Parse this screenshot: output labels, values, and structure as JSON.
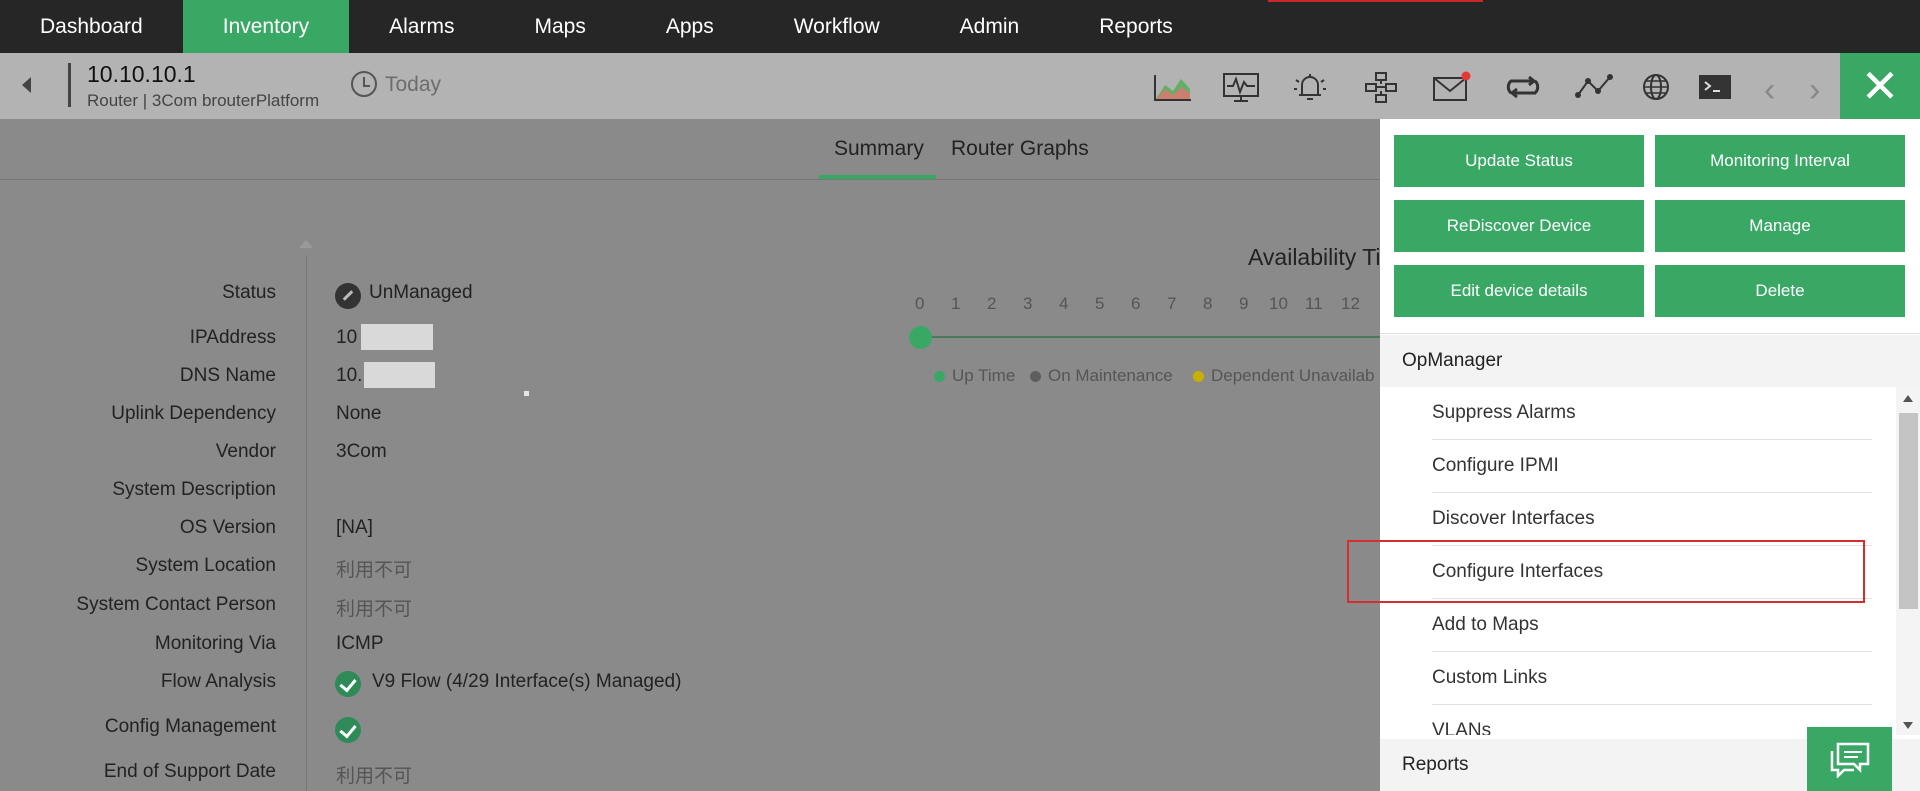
{
  "topnav": {
    "items": [
      {
        "label": "Dashboard",
        "active": false
      },
      {
        "label": "Inventory",
        "active": true
      },
      {
        "label": "Alarms",
        "active": false
      },
      {
        "label": "Maps",
        "active": false
      },
      {
        "label": "Apps",
        "active": false
      },
      {
        "label": "Workflow",
        "active": false
      },
      {
        "label": "Admin",
        "active": false
      },
      {
        "label": "Reports",
        "active": false
      }
    ]
  },
  "device": {
    "name": "10.10.10.1",
    "subtitle": "Router | 3Com brouterPlatform",
    "period": "Today"
  },
  "toolbar": {
    "icons": [
      "area-chart-icon",
      "monitor-icon",
      "alarm-bell-icon",
      "workflow-icon",
      "mail-icon",
      "sync-icon",
      "topology-icon",
      "globe-icon",
      "terminal-icon"
    ],
    "prev_symbol": "‹",
    "next_symbol": "›",
    "close_symbol": "✕"
  },
  "tabs": [
    {
      "label": "Summary",
      "active": true
    },
    {
      "label": "Router Graphs",
      "active": false
    }
  ],
  "details": [
    {
      "label": "Status",
      "value": "UnManaged"
    },
    {
      "label": "IPAddress",
      "value": "10"
    },
    {
      "label": "DNS Name",
      "value": "10."
    },
    {
      "label": "Uplink Dependency",
      "value": "None"
    },
    {
      "label": "Vendor",
      "value": "3Com"
    },
    {
      "label": "System Description",
      "value": ""
    },
    {
      "label": "OS Version",
      "value": "[NA]"
    },
    {
      "label": "System Location",
      "value": "利用不可"
    },
    {
      "label": "System Contact Person",
      "value": "利用不可"
    },
    {
      "label": "Monitoring Via",
      "value": "ICMP"
    },
    {
      "label": "Flow Analysis",
      "value": "V9 Flow (4/29 Interface(s) Managed)"
    },
    {
      "label": "Config Management",
      "value": ""
    },
    {
      "label": "End of Support Date",
      "value": "利用不可"
    }
  ],
  "availability": {
    "title": "Availability Ti",
    "hours": [
      "0",
      "1",
      "2",
      "3",
      "4",
      "5",
      "6",
      "7",
      "8",
      "9",
      "10",
      "11",
      "12"
    ],
    "legend": [
      {
        "label": "Up Time",
        "color": "#3aa865"
      },
      {
        "label": "On Maintenance",
        "color": "#5e5e5e"
      },
      {
        "label": "Dependent Unavailab",
        "color": "#c9b000"
      }
    ]
  },
  "panel": {
    "buttons": [
      "Update Status",
      "Monitoring Interval",
      "ReDiscover Device",
      "Manage",
      "Edit device details",
      "Delete"
    ],
    "opmanager_title": "OpManager",
    "menu_items": [
      "Suppress Alarms",
      "Configure IPMI",
      "Discover Interfaces",
      "Configure Interfaces",
      "Add to Maps",
      "Custom Links",
      "VLANs"
    ],
    "highlighted_item": "Configure Interfaces",
    "reports_title": "Reports"
  },
  "colors": {
    "accent": "#3aa865",
    "nav_bg": "#262626",
    "highlight_border": "#d32f2f"
  }
}
